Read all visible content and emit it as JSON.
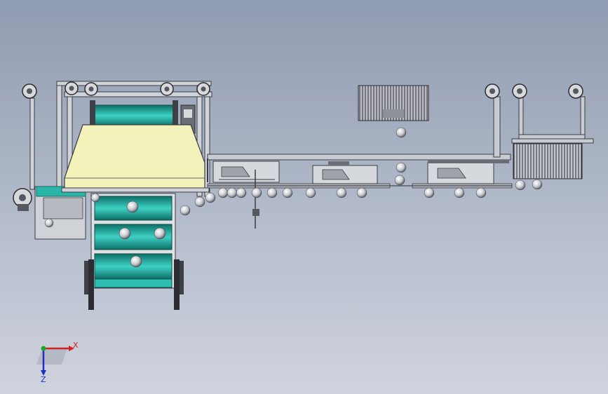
{
  "viewport": {
    "background_top": "#8f9bb0",
    "background_bottom": "#cfd3dd"
  },
  "model": {
    "frame_color": "#c9ccd2",
    "frame_edge": "#3a3d44",
    "teal_color": "#1aa392",
    "teal_dark": "#0e6e63",
    "hopper_color": "#f3f1b8",
    "tank_color": "#2fbfb2"
  },
  "triad": {
    "x_label": "X",
    "z_label": "Z",
    "x_color": "#d42020",
    "y_color": "#1aa82a",
    "z_color": "#1d2fc4"
  }
}
